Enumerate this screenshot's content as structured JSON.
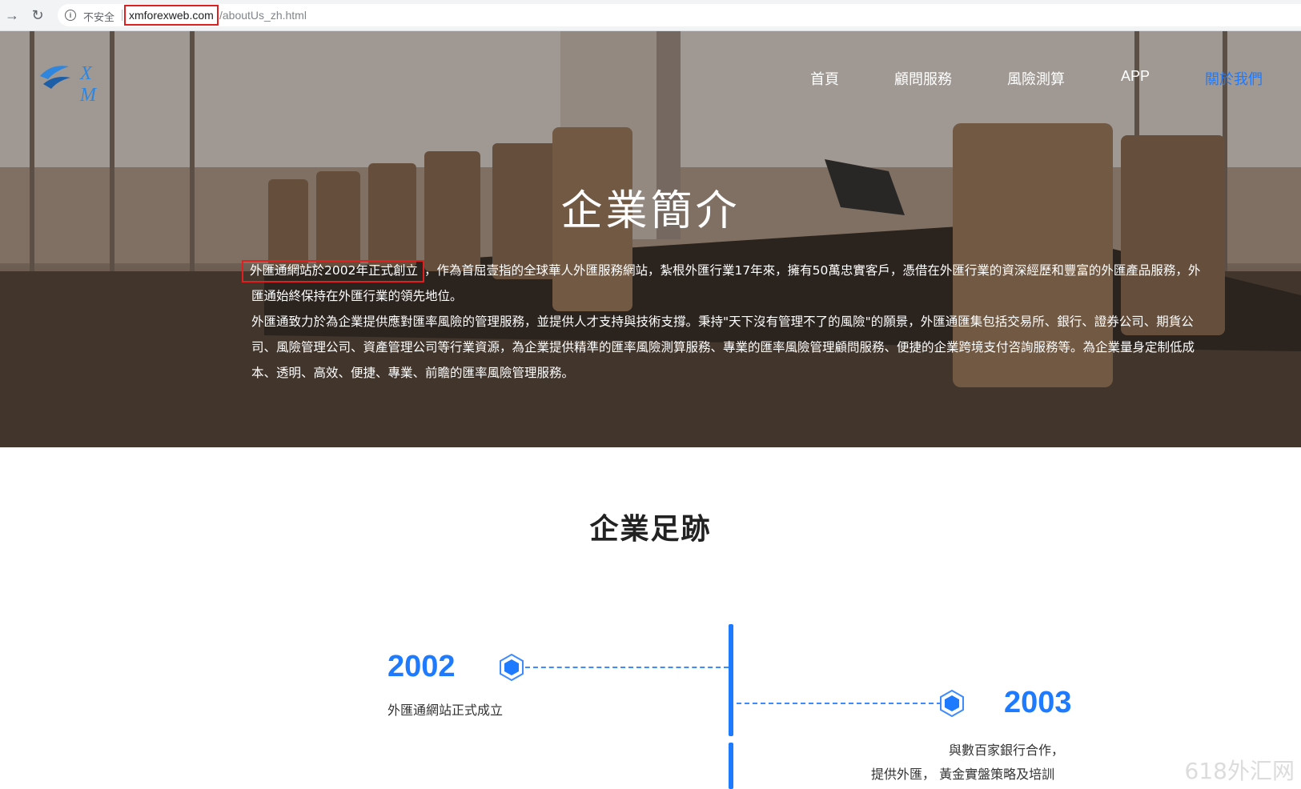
{
  "browser": {
    "security_label": "不安全",
    "url_domain": "xmforexweb.com",
    "url_path": "/aboutUs_zh.html"
  },
  "logo": {
    "text": "X M"
  },
  "nav": {
    "items": [
      {
        "label": "首頁"
      },
      {
        "label": "顧問服務"
      },
      {
        "label": "風險測算"
      },
      {
        "label": "APP"
      },
      {
        "label": "關於我們"
      }
    ],
    "active_color": "#1e7bff"
  },
  "hero": {
    "title": "企業簡介",
    "para1_highlight": "外匯通網站於2002年正式創立",
    "para1_rest": "，作為首屈壹指的全球華人外匯服務網站，紮根外匯行業17年來，擁有50萬忠實客戶，憑借在外匯行業的資深經歷和豐富的外匯產品服務，外匯通始終保持在外匯行業的領先地位。",
    "para2": "外匯通致力於為企業提供應對匯率風險的管理服務，並提供人才支持與技術支撐。秉持\"天下沒有管理不了的風險\"的願景，外匯通匯集包括交易所、銀行、證券公司、期貨公司、風險管理公司、資產管理公司等行業資源，為企業提供精準的匯率風險測算服務、專業的匯率風險管理顧問服務、便捷的企業跨境支付咨詢服務等。為企業量身定制低成本、透明、高效、便捷、專業、前瞻的匯率風險管理服務。"
  },
  "footprint": {
    "title": "企業足跡",
    "events": [
      {
        "year": "2002",
        "lines": [
          "外匯通網站正式成立"
        ]
      },
      {
        "year": "2003",
        "lines": [
          "與數百家銀行合作，",
          "提供外匯， 黃金實盤策略及培訓"
        ]
      }
    ],
    "accent_color": "#1e7bff"
  },
  "watermark": "618外汇网"
}
